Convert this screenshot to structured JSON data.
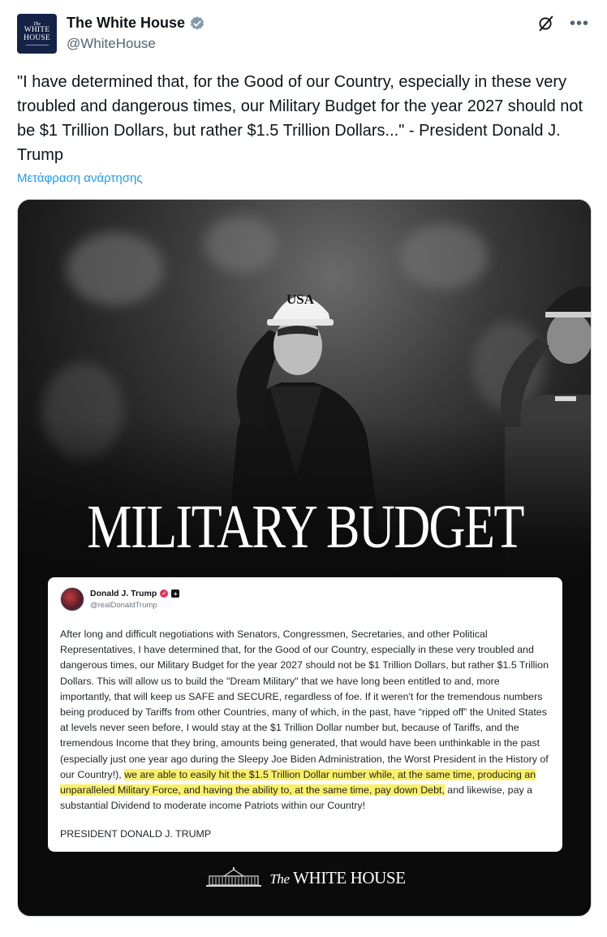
{
  "header": {
    "avatar_small": "The",
    "avatar_line1": "WHITE",
    "avatar_line2": "HOUSE",
    "display_name": "The White House",
    "handle": "@WhiteHouse",
    "verified_color": "#829aab"
  },
  "tweet": {
    "text": "\"I have determined that, for the Good of our Country, especially in these very troubled and dangerous times, our Military Budget for the year 2027 should not be $1 Trillion Dollars, but rather $1.5 Trillion Dollars...\" - President Donald J. Trump",
    "translate_link": "Μετάφραση ανάρτησης"
  },
  "media": {
    "cap_text": "USA",
    "headline": "MILITARY BUDGET",
    "truth_post": {
      "name": "Donald J. Trump",
      "handle": "@realDonaldTrump",
      "body_plain": "After long and difficult negotiations with Senators, Congressmen, Secretaries, and other Political Representatives, I have determined that, for the Good of our Country, especially in these very troubled and dangerous times, our Military Budget for the year 2027 should not be $1 Trillion Dollars, but rather $1.5 Trillion Dollars. This will allow us to build the \"Dream Military\" that we have long been entitled to and, more importantly, that will keep us SAFE and SECURE, regardless of foe. If it weren't for the tremendous numbers being produced by Tariffs from other Countries, many of which, in the past, have “ripped off” the United States at levels never seen before, I would stay at the $1 Trillion Dollar number but, because of Tariffs, and the tremendous Income that they bring, amounts being generated, that would have been unthinkable in the past (especially just one year ago during the Sleepy Joe Biden Administration, the Worst President in the History of our Country!), ",
      "body_highlight": "we are able to easily hit the $1.5 Trillion Dollar number while, at the same time, producing an unparalleled Military Force, and having the ability to, at the same time, pay down Debt,",
      "body_tail": " and likewise, pay a substantial Dividend to moderate income Patriots within our Country!",
      "signature": "PRESIDENT DONALD J. TRUMP"
    },
    "footer_the": "The",
    "footer_wh": "WHITE HOUSE"
  },
  "colors": {
    "link": "#1d9bf0",
    "highlight": "#fcf068",
    "media_bg": "#0b0b0b"
  }
}
